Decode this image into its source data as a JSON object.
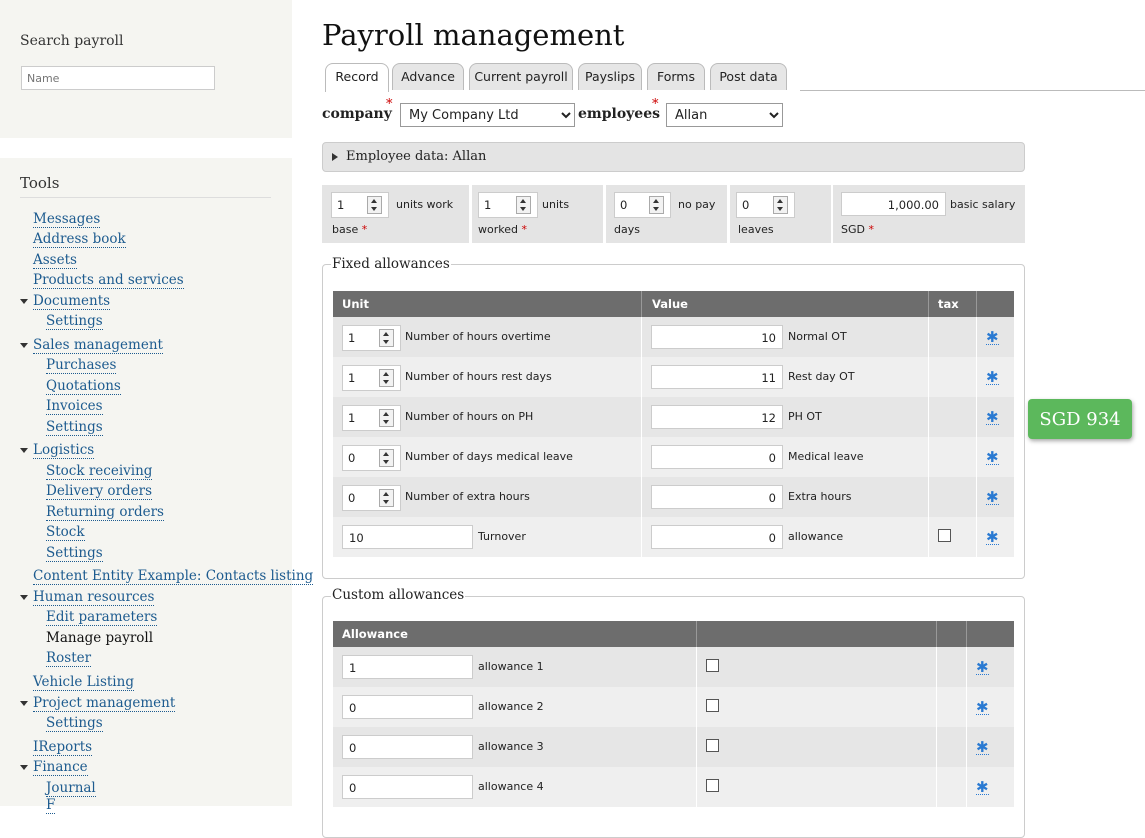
{
  "sidebar": {
    "search": {
      "title": "Search payroll",
      "placeholder": "Name"
    },
    "tools": {
      "title": "Tools",
      "items": [
        {
          "label": "Messages"
        },
        {
          "label": "Address book"
        },
        {
          "label": "Assets"
        },
        {
          "label": "Products and services"
        },
        {
          "label": "Documents",
          "expanded": true
        },
        {
          "label": "Settings"
        },
        {
          "label": "Sales management",
          "expanded": true
        },
        {
          "label": "Purchases"
        },
        {
          "label": "Quotations"
        },
        {
          "label": "Invoices"
        },
        {
          "label": "Settings"
        },
        {
          "label": "Logistics",
          "expanded": true
        },
        {
          "label": "Stock receiving"
        },
        {
          "label": "Delivery orders"
        },
        {
          "label": "Returning orders"
        },
        {
          "label": "Stock"
        },
        {
          "label": "Settings"
        },
        {
          "label": "Content Entity Example: Contacts listing"
        },
        {
          "label": "Human resources",
          "expanded": true
        },
        {
          "label": "Edit parameters"
        },
        {
          "label": "Manage payroll",
          "active": true
        },
        {
          "label": "Roster"
        },
        {
          "label": "Vehicle Listing"
        },
        {
          "label": "Project management",
          "expanded": true
        },
        {
          "label": "Settings"
        },
        {
          "label": "IReports"
        },
        {
          "label": "Finance",
          "expanded": true
        },
        {
          "label": "Journal"
        },
        {
          "label": "F"
        }
      ]
    }
  },
  "main": {
    "title": "Payroll management",
    "tabs": [
      {
        "label": "Record",
        "active": true
      },
      {
        "label": "Advance"
      },
      {
        "label": "Current payroll"
      },
      {
        "label": "Payslips"
      },
      {
        "label": "Forms"
      },
      {
        "label": "Post data"
      }
    ],
    "company": {
      "label": "company",
      "required_mark": "*",
      "value": "My Company Ltd"
    },
    "employees": {
      "label": "employees",
      "required_mark": "*",
      "value": "Allan"
    },
    "employee_data": {
      "label": "Employee data: Allan"
    },
    "base": {
      "units_work": {
        "value": "1",
        "label": "units work",
        "label2": "base",
        "required_mark": "*"
      },
      "units_worked": {
        "value": "1",
        "label": "units",
        "label2": "worked",
        "required_mark": "*"
      },
      "no_pay": {
        "value": "0",
        "label": "no pay",
        "label2": "days"
      },
      "leaves": {
        "value": "0",
        "label2": "leaves"
      },
      "salary": {
        "value": "1,000.00",
        "label": "basic salary",
        "label2": "SGD",
        "required_mark": "*"
      }
    },
    "fixed_allowances": {
      "legend": "Fixed allowances",
      "headers": {
        "unit": "Unit",
        "value": "Value",
        "tax": "tax"
      },
      "rows": [
        {
          "unit": "1",
          "unit_label": "Number of hours overtime",
          "value": "10",
          "value_label": "Normal OT",
          "star": "✱"
        },
        {
          "unit": "1",
          "unit_label": "Number of hours rest days",
          "value": "11",
          "value_label": "Rest day OT",
          "star": "✱"
        },
        {
          "unit": "1",
          "unit_label": "Number of hours on PH",
          "value": "12",
          "value_label": "PH OT",
          "star": "✱"
        },
        {
          "unit": "0",
          "unit_label": "Number of days medical leave",
          "value": "0",
          "value_label": "Medical leave",
          "star": "✱"
        },
        {
          "unit": "0",
          "unit_label": "Number of extra hours",
          "value": "0",
          "value_label": "Extra hours",
          "star": "✱"
        },
        {
          "unit": "10",
          "unit_label": "Turnover",
          "value": "0",
          "value_label": "allowance",
          "star": "✱",
          "tax_checked": false
        }
      ]
    },
    "custom_allowances": {
      "legend": "Custom allowances",
      "headers": {
        "allowance": "Allowance"
      },
      "rows": [
        {
          "value": "1",
          "label": "allowance 1",
          "star": "✱",
          "checked": false
        },
        {
          "value": "0",
          "label": "allowance 2",
          "star": "✱",
          "checked": false
        },
        {
          "value": "0",
          "label": "allowance 3",
          "star": "✱",
          "checked": false
        },
        {
          "value": "0",
          "label": "allowance 4",
          "star": "✱",
          "checked": false
        }
      ]
    },
    "total_badge": "SGD 934",
    "colors": {
      "link": "#1d5b8f",
      "badge": "#5cb85c",
      "header": "#6d6d6d",
      "star": "#2a7ad2",
      "required": "#cc0000"
    }
  }
}
